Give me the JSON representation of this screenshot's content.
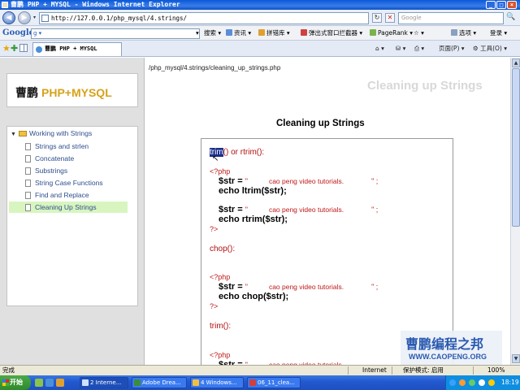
{
  "window": {
    "title": "曹鹏 PHP + MYSQL - Windows Internet Explorer",
    "min": "_",
    "max": "□",
    "close": "×"
  },
  "address": {
    "back": "◀",
    "forward": "▶",
    "dropdown": "▾",
    "url": "http://127.0.0.1/php_mysql/4.strings/",
    "refresh": "↻",
    "stop": "✕",
    "search_placeholder": "Google",
    "search_icon": "🔍"
  },
  "google_toolbar": {
    "logo": "Google",
    "search_value": "g ▾",
    "items": [
      "▾",
      "搜索 ▾",
      "资讯 ▾",
      "拼错库 ▾",
      "弹出式窗口拦截器 ▾",
      "PageRank ▾",
      "☆ ▾",
      "选项 ▾",
      "登录 ▾"
    ]
  },
  "tabbar": {
    "tab_title": "曹鹏 PHP + MYSQL",
    "commands": [
      "⌂ ▾",
      "⛁ ▾",
      "⎙ ▾",
      "页面(P) ▾",
      "⚙ 工具(O) ▾"
    ]
  },
  "page": {
    "breadcrumb": "/php_mysql/4.strings/cleaning_up_strings.php",
    "watermark_title": "Cleaning up Strings",
    "logo_cn": "曹鹏",
    "logo_en": "PHP+MYSQL",
    "nav_root": "Working with Strings",
    "nav_items": [
      "Strings and strlen",
      "Concatenate",
      "Substrings",
      "String Case Functions",
      "Find and Replace",
      "Cleaning Up Strings"
    ],
    "content_title": "Cleaning up Strings"
  },
  "code": {
    "trim_sel": "trim",
    "trim_rest": "() or rtrim():",
    "open_tag": "<?php",
    "close_tag": "?>",
    "str_lhs": "$str =",
    "str_open": "\"",
    "str_val": "cao peng video tutorials.",
    "str_close": "\" ;",
    "echo_ltrim": "echo ltrim($str);",
    "echo_rtrim": "echo rtrim($str);",
    "chop_label": "chop():",
    "echo_chop": "echo chop($str);",
    "trim_label": "trim():"
  },
  "brand": {
    "name_cn": "曹鹏编程之邦",
    "url": "WWW.CAOPENG.ORG"
  },
  "statusbar": {
    "left": "完成",
    "zone": "Internet",
    "protected": "保护模式: 启用",
    "zoom": "100%"
  },
  "taskbar": {
    "start": "开始",
    "tasks": [
      "2 Interne...",
      "Adobe Drea...",
      "4 Windows...",
      "06_11_clea..."
    ],
    "clock": "18:19"
  },
  "colors": {
    "accent_blue": "#2e4f8c",
    "code_red": "#c01818",
    "logo_gold": "#d6a21a",
    "active_nav": "#d8f5c0"
  }
}
